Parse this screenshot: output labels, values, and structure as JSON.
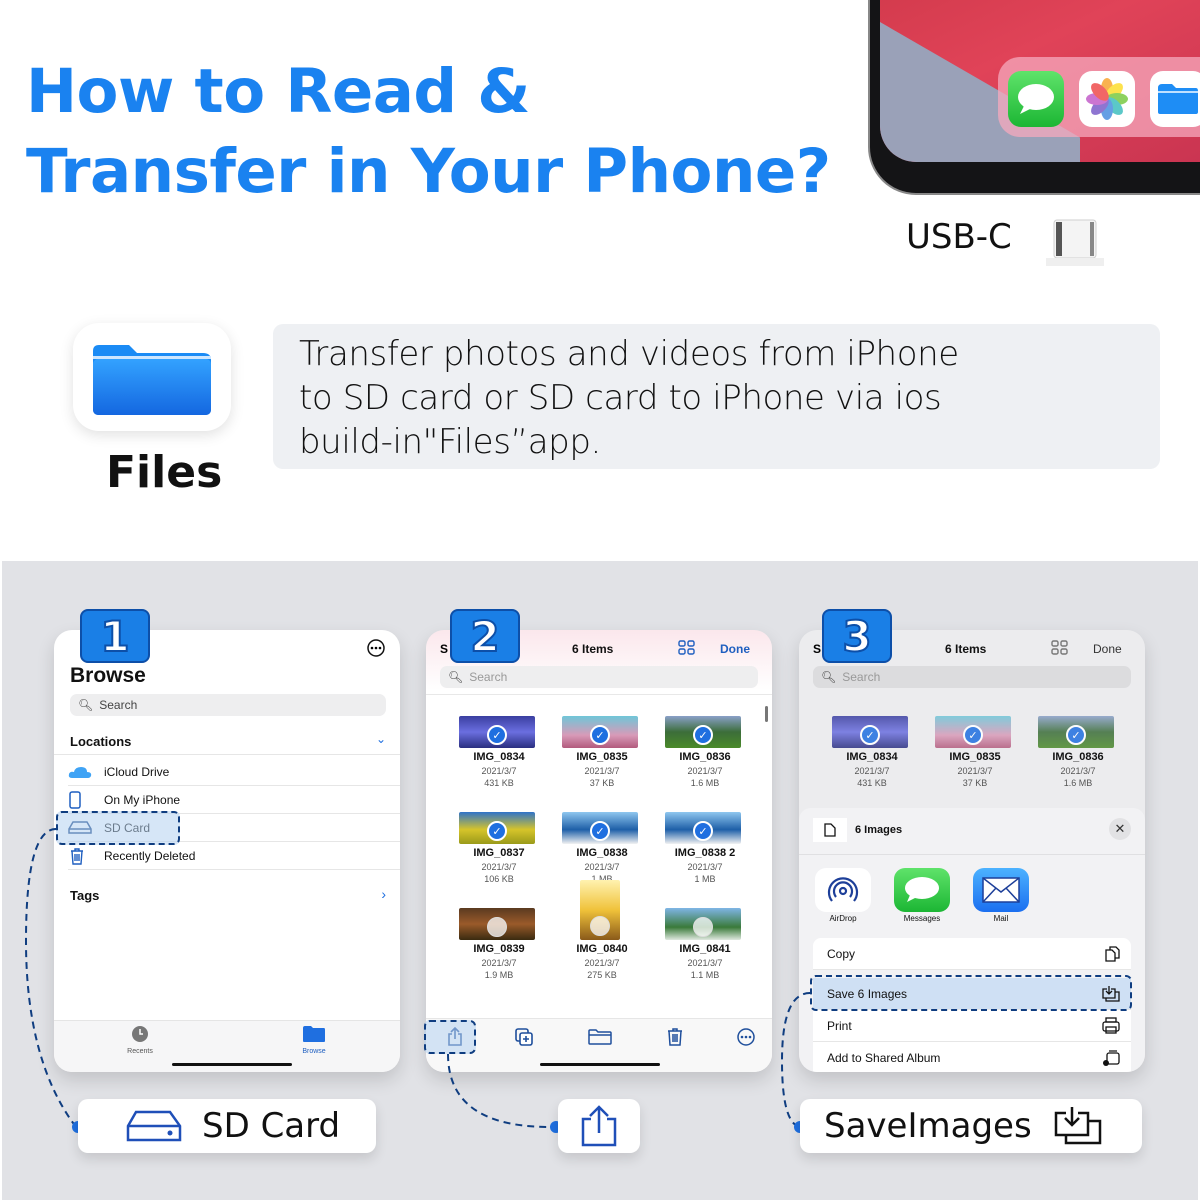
{
  "headline": {
    "line1": "How to Read &",
    "line2": "Transfer in Your Phone?"
  },
  "device": {
    "connector_label": "USB-C",
    "dock_apps": [
      "messages-app",
      "photos-app",
      "files-app"
    ]
  },
  "files_app": {
    "icon": "files-folder-icon",
    "label": "Files",
    "description": "Transfer photos and videos from iPhone\nto SD card or SD card to iPhone via ios\nbuild-in\"Files”app."
  },
  "steps": [
    {
      "number": "1",
      "screen": {
        "title": "Browse",
        "search_placeholder": "Search",
        "locations_header": "Locations",
        "locations": [
          {
            "label": "iCloud Drive",
            "icon": "cloud-icon"
          },
          {
            "label": "On My iPhone",
            "icon": "phone-icon"
          },
          {
            "label": "SD Card",
            "icon": "drive-icon",
            "highlighted": true
          },
          {
            "label": "Recently Deleted",
            "icon": "trash-icon"
          }
        ],
        "tags_header": "Tags",
        "tabbar": [
          {
            "label": "Recents",
            "icon": "clock-icon",
            "active": false
          },
          {
            "label": "Browse",
            "icon": "folder-icon",
            "active": true
          }
        ]
      },
      "callout": {
        "label": "SD Card",
        "icon": "drive-icon"
      }
    },
    {
      "number": "2",
      "screen": {
        "left_action": "S",
        "title": "6 Items",
        "done": "Done",
        "search_placeholder": "Search",
        "files": [
          {
            "name": "IMG_0834",
            "date": "2021/3/7",
            "size": "431 KB",
            "selected": true
          },
          {
            "name": "IMG_0835",
            "date": "2021/3/7",
            "size": "37 KB",
            "selected": true
          },
          {
            "name": "IMG_0836",
            "date": "2021/3/7",
            "size": "1.6 MB",
            "selected": true
          },
          {
            "name": "IMG_0837",
            "date": "2021/3/7",
            "size": "106 KB",
            "selected": true
          },
          {
            "name": "IMG_0838",
            "date": "2021/3/7",
            "size": "1 MB",
            "selected": true
          },
          {
            "name": "IMG_0838 2",
            "date": "2021/3/7",
            "size": "1 MB",
            "selected": true
          },
          {
            "name": "IMG_0839",
            "date": "2021/3/7",
            "size": "1.9 MB",
            "selected": false
          },
          {
            "name": "IMG_0840",
            "date": "2021/3/7",
            "size": "275 KB",
            "selected": false
          },
          {
            "name": "IMG_0841",
            "date": "2021/3/7",
            "size": "1.1 MB",
            "selected": false
          }
        ],
        "toolbar": [
          "share-icon",
          "duplicate-icon",
          "folder-icon",
          "trash-icon",
          "more-icon"
        ]
      },
      "callout": {
        "icon": "share-icon"
      }
    },
    {
      "number": "3",
      "screen": {
        "left_action": "S",
        "title": "6 Items",
        "done": "Done",
        "search_placeholder": "Search",
        "files": [
          {
            "name": "IMG_0834",
            "date": "2021/3/7",
            "size": "431 KB"
          },
          {
            "name": "IMG_0835",
            "date": "2021/3/7",
            "size": "37 KB"
          },
          {
            "name": "IMG_0836",
            "date": "2021/3/7",
            "size": "1.6 MB"
          }
        ],
        "sheet": {
          "title": "6 Images",
          "apps": [
            {
              "label": "AirDrop",
              "icon": "airdrop-icon"
            },
            {
              "label": "Messages",
              "icon": "messages-icon"
            },
            {
              "label": "Mail",
              "icon": "mail-icon"
            }
          ],
          "actions": [
            {
              "label": "Copy",
              "icon": "copy-icon"
            },
            {
              "label": "Save 6 Images",
              "icon": "save-images-icon",
              "highlighted": true
            },
            {
              "label": "Print",
              "icon": "print-icon"
            },
            {
              "label": "Add to Shared Album",
              "icon": "shared-album-icon"
            }
          ]
        }
      },
      "callout": {
        "label": "SaveImages",
        "icon": "save-images-icon"
      }
    }
  ],
  "colors": {
    "accent": "#1a82f0",
    "badge": "#1a7fe6",
    "dashed_highlight": "#0f3d80",
    "panel_bg": "#e1e2e6"
  }
}
